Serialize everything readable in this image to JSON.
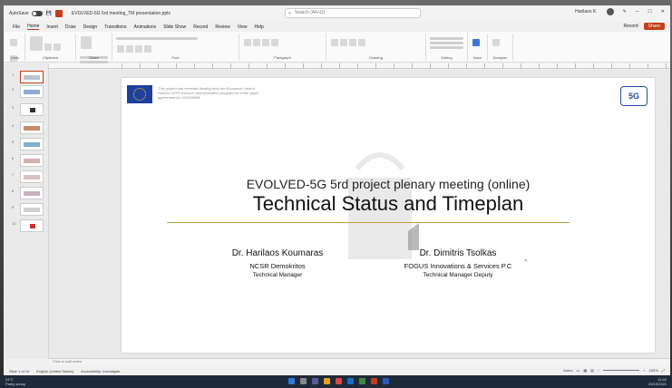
{
  "window": {
    "autosave_label": "AutoSave",
    "document_title": "EVOLVED-5G 5rd meeting_TM presentation.pptx",
    "search_placeholder": "Search (Alt+Q)",
    "user_name": "Harilaos K."
  },
  "menu": {
    "items": [
      "File",
      "Home",
      "Insert",
      "Draw",
      "Design",
      "Transitions",
      "Animations",
      "Slide Show",
      "Record",
      "Review",
      "View",
      "Help"
    ],
    "active_index": 1,
    "record_label": "Record",
    "share_label": "Share"
  },
  "ribbon": {
    "groups": [
      "Undo",
      "Clipboard",
      "Slides",
      "Font",
      "Paragraph",
      "Drawing",
      "Editing",
      "Voice",
      "Designer"
    ]
  },
  "thumbnails": {
    "numbers": [
      "1",
      "2",
      "3",
      "4",
      "5",
      "6",
      "7",
      "8",
      "9",
      "10"
    ]
  },
  "slide": {
    "eu_text": "This project has received funding from the European Union's Horizon 2020 research and innovation programme under grant agreement No 101016608",
    "logo_text": "5G",
    "subtitle": "EVOLVED-5G 5rd project plenary meeting (online)",
    "title": "Technical Status and Timeplan",
    "authors": [
      {
        "name": "Dr. Harilaos Koumaras",
        "org": "NCSR Demokritos",
        "role": "Technical Manager"
      },
      {
        "name": "Dr. Dimitris Tsolkas",
        "org": "FOGUS Innovations & Services P.C",
        "role": "Technical Manager Deputy"
      }
    ]
  },
  "notes_placeholder": "Click to add notes",
  "status": {
    "slide_info": "Slide 1 of 10",
    "language": "English (United States)",
    "accessibility": "Accessibility: Investigate",
    "notes_label": "Notes",
    "zoom": "100%"
  },
  "taskbar": {
    "weather_temp": "24°C",
    "weather_desc": "Partly sunny",
    "time": "11:42",
    "date": "25/10/2021"
  },
  "colors": {
    "accent": "#c43e1c",
    "divider": "#c89a3e",
    "eu_blue": "#1f3f9c"
  }
}
